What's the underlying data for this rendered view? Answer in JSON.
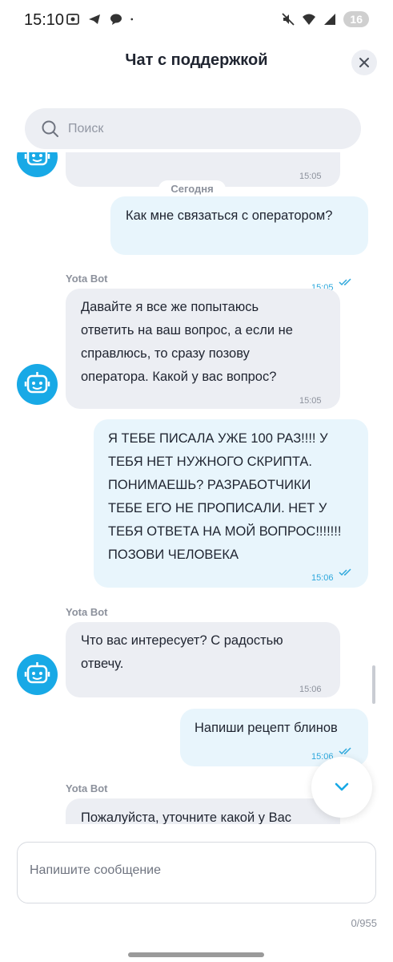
{
  "status_bar": {
    "time": "15:10",
    "battery": "16",
    "left_icons": [
      "screenshot-icon",
      "telegram-icon",
      "chat-icon",
      "dot-icon"
    ],
    "right_icons": [
      "mute-icon",
      "wifi-icon",
      "signal-icon",
      "battery-icon"
    ]
  },
  "header": {
    "title": "Чат с поддержкой",
    "close_icon": "close-icon"
  },
  "search": {
    "placeholder": "Поиск",
    "value": ""
  },
  "chat": {
    "day_label": "Сегодня",
    "messages": [
      {
        "from": "bot",
        "time": "15:05",
        "text": ""
      },
      {
        "from": "user",
        "time": "15:05",
        "text": "Как мне связаться с оператором?",
        "read": true
      },
      {
        "from": "bot",
        "sender": "Yota Bot",
        "time": "15:05",
        "lines": [
          "Давайте я все же попытаюсь",
          "ответить на ваш вопрос, а если не",
          "справлюсь, то сразу позову",
          "оператора. Какой у вас вопрос?"
        ]
      },
      {
        "from": "user",
        "time": "15:06",
        "read": true,
        "lines": [
          "Я ТЕБЕ ПИСАЛА УЖЕ 100 РАЗ!!!! У",
          "ТЕБЯ НЕТ НУЖНОГО СКРИПТА.",
          "ПОНИМАЕШЬ? РАЗРАБОТЧИКИ",
          "ТЕБЕ ЕГО НЕ ПРОПИСАЛИ. НЕТ У",
          "ТЕБЯ ОТВЕТА НА МОЙ ВОПРОС!!!!!!!",
          "ПОЗОВИ ЧЕЛОВЕКА"
        ]
      },
      {
        "from": "bot",
        "sender": "Yota Bot",
        "time": "15:06",
        "lines": [
          "Что вас интересует? С радостью",
          "отвечу."
        ]
      },
      {
        "from": "user",
        "time": "15:06",
        "text": "Напиши рецепт блинов",
        "read": true
      },
      {
        "from": "bot",
        "sender": "Yota Bot",
        "text": "Пожалуйста, уточните какой у Вас"
      }
    ]
  },
  "composer": {
    "placeholder": "Напишите сообщение",
    "value": "",
    "counter": "0/955"
  },
  "colors": {
    "accent": "#18a9e6",
    "bot_bubble": "#eceef3",
    "user_bubble": "#e8f5fc",
    "tick": "#2ea8dc"
  }
}
